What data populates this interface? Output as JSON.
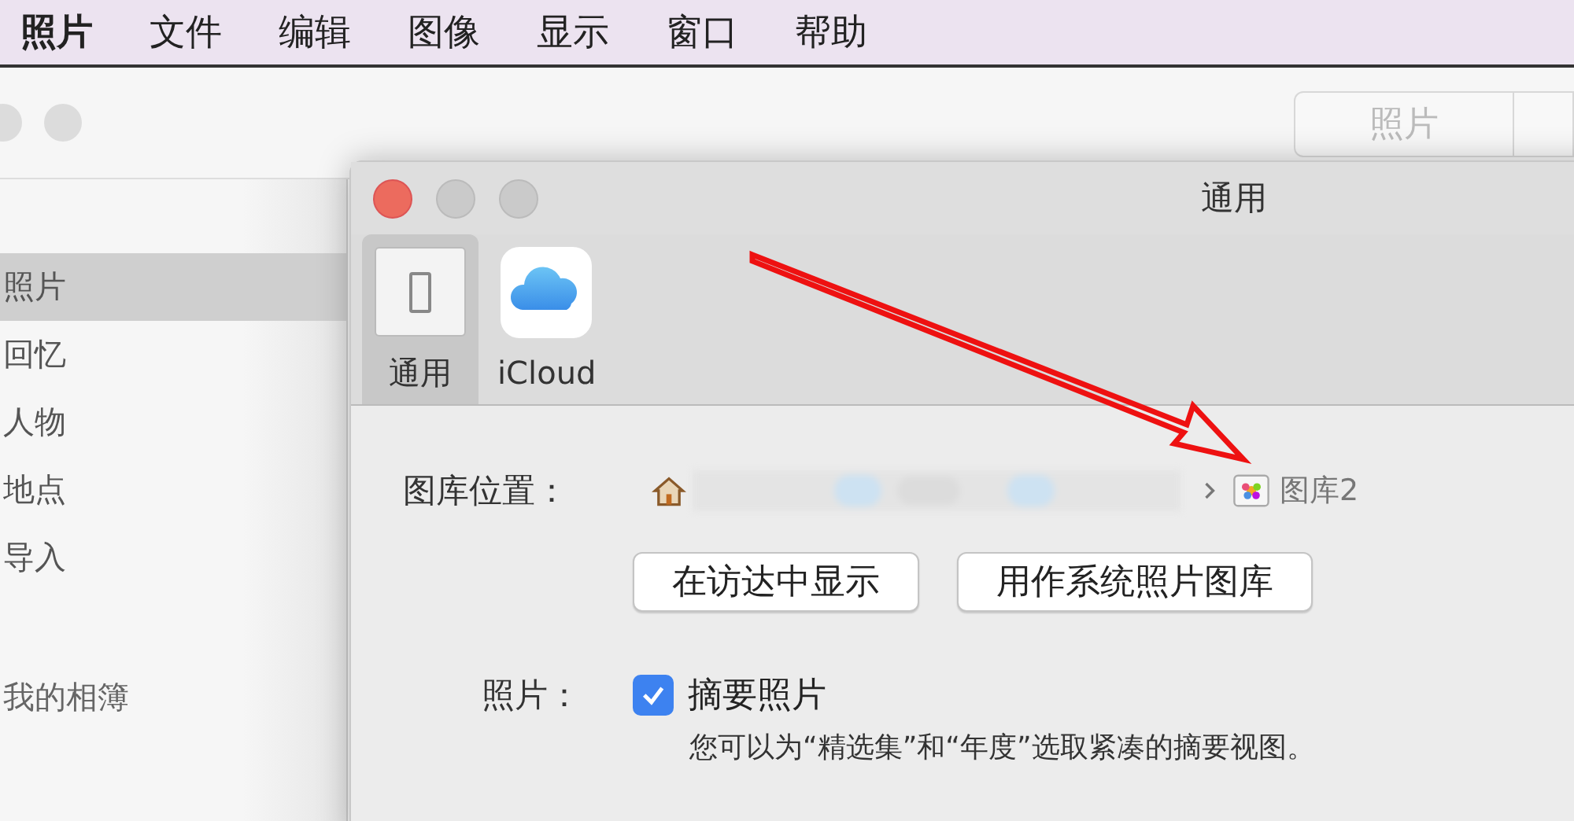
{
  "menu_bar": {
    "items": [
      {
        "label": "照片",
        "kind": "app"
      },
      {
        "label": "文件",
        "kind": "menu"
      },
      {
        "label": "编辑",
        "kind": "menu"
      },
      {
        "label": "图像",
        "kind": "menu"
      },
      {
        "label": "显示",
        "kind": "menu"
      },
      {
        "label": "窗口",
        "kind": "menu"
      },
      {
        "label": "帮助",
        "kind": "menu"
      }
    ]
  },
  "main_window": {
    "segment": "照片",
    "sidebar": {
      "items": [
        {
          "label": "照片",
          "selected": true
        },
        {
          "label": "回忆",
          "selected": false
        },
        {
          "label": "人物",
          "selected": false
        },
        {
          "label": "地点",
          "selected": false
        },
        {
          "label": "导入",
          "selected": false
        }
      ],
      "section": "我的相簿"
    }
  },
  "preferences": {
    "title": "通用",
    "tabs": [
      {
        "label": "通用",
        "kind": "general",
        "selected": true
      },
      {
        "label": "iCloud",
        "kind": "icloud",
        "selected": false
      }
    ],
    "library_location": {
      "label": "图库位置：",
      "library": "图库2"
    },
    "buttons": [
      "在访达中显示",
      "用作系统照片图库"
    ],
    "photos": {
      "label": "照片：",
      "checkbox": {
        "label": "摘要照片",
        "checked": true
      },
      "description": "您可以为“精选集”和“年度”选取紧凑的摘要视图。"
    }
  }
}
